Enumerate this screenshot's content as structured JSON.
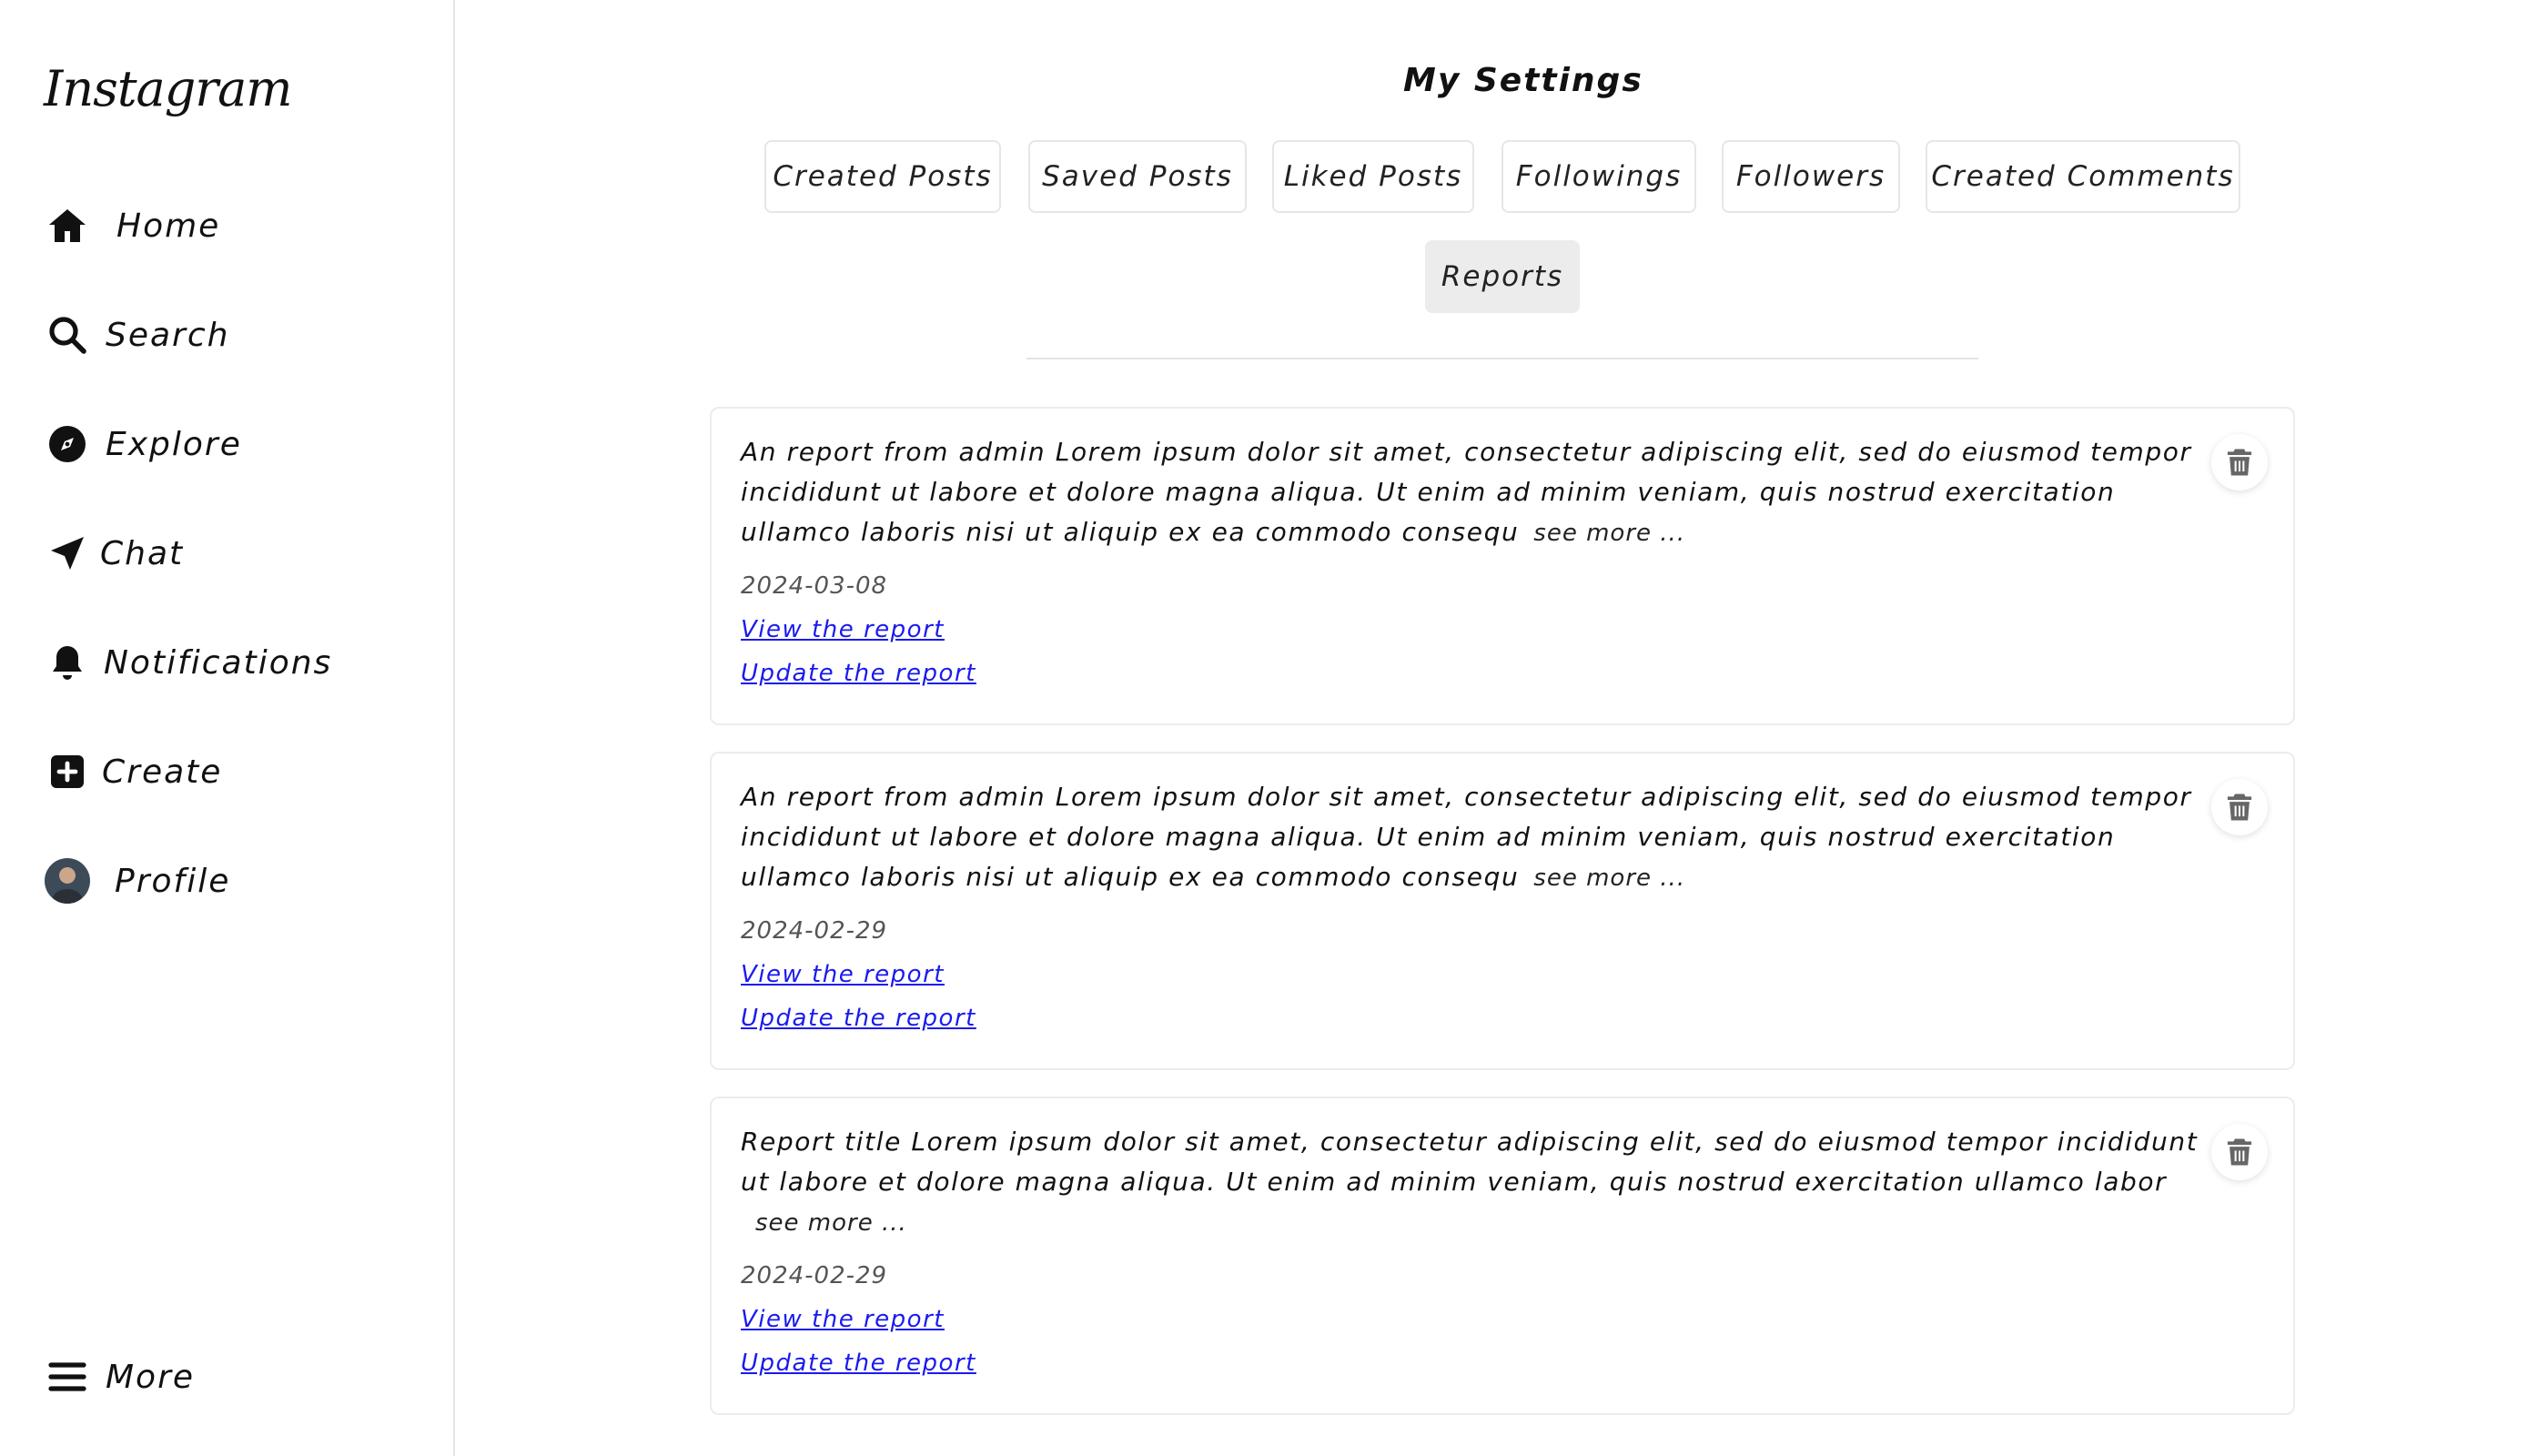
{
  "sidebar": {
    "logo": "Instagram",
    "items": [
      {
        "label": "Home",
        "icon": "home-icon"
      },
      {
        "label": "Search",
        "icon": "search-icon"
      },
      {
        "label": "Explore",
        "icon": "compass-icon"
      },
      {
        "label": "Chat",
        "icon": "paper-plane-icon"
      },
      {
        "label": "Notifications",
        "icon": "bell-icon"
      },
      {
        "label": "Create",
        "icon": "plus-square-icon"
      },
      {
        "label": "Profile",
        "icon": "avatar"
      }
    ],
    "more": {
      "label": "More",
      "icon": "hamburger-icon"
    }
  },
  "main": {
    "title": "My Settings",
    "tabs": [
      {
        "label": "Created Posts"
      },
      {
        "label": "Saved Posts"
      },
      {
        "label": "Liked Posts"
      },
      {
        "label": "Followings"
      },
      {
        "label": "Followers"
      },
      {
        "label": "Created Comments"
      },
      {
        "label": "Reports",
        "active": true
      }
    ],
    "reports": [
      {
        "text": "An report from admin Lorem ipsum dolor sit amet, consectetur adipiscing elit, sed do eiusmod tempor incididunt ut labore et dolore magna aliqua. Ut enim ad minim veniam, quis nostrud exercitation ullamco laboris nisi ut aliquip ex ea commodo consequ",
        "see_more": "see more ...",
        "date": "2024-03-08",
        "view_link": "View the report",
        "update_link": "Update the report"
      },
      {
        "text": "An report from admin Lorem ipsum dolor sit amet, consectetur adipiscing elit, sed do eiusmod tempor incididunt ut labore et dolore magna aliqua. Ut enim ad minim veniam, quis nostrud exercitation ullamco laboris nisi ut aliquip ex ea commodo consequ",
        "see_more": "see more ...",
        "date": "2024-02-29",
        "view_link": "View the report",
        "update_link": "Update the report"
      },
      {
        "text": "Report title Lorem ipsum dolor sit amet, consectetur adipiscing elit, sed do eiusmod tempor incididunt ut labore et dolore magna aliqua. Ut enim ad minim veniam, quis nostrud exercitation ullamco labor",
        "see_more": "see more ...",
        "date": "2024-02-29",
        "view_link": "View the report",
        "update_link": "Update the report"
      }
    ]
  },
  "colors": {
    "link": "#1a1aee",
    "active_tab": "#ececec",
    "border": "#e4e4e4"
  }
}
